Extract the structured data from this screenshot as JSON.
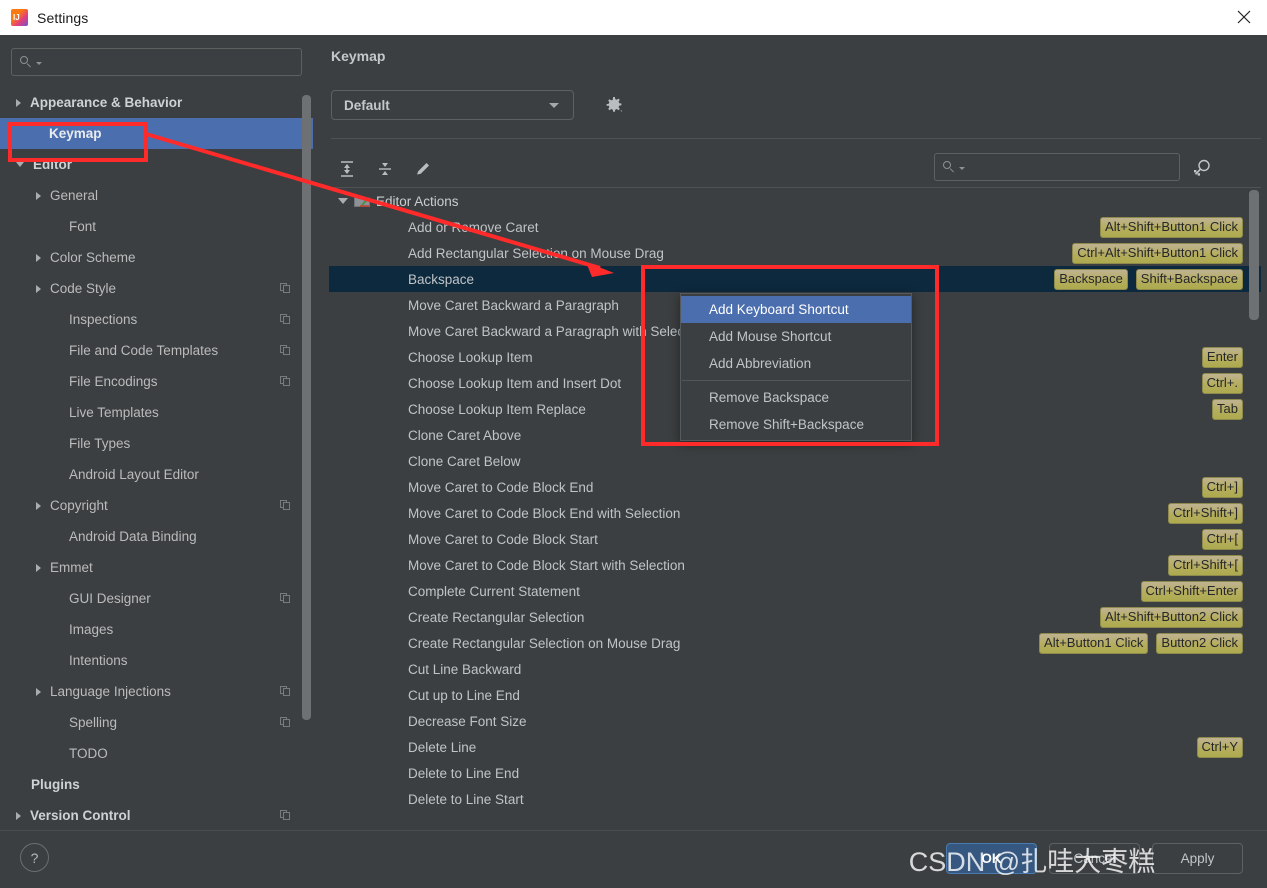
{
  "window": {
    "title": "Settings",
    "app_icon": "intellij-idea-icon",
    "close_icon": "close-icon"
  },
  "sidebar": {
    "search": {
      "placeholder": "",
      "value": "",
      "icon": "search-icon"
    },
    "items": [
      {
        "label": "Appearance & Behavior",
        "arrow": "right",
        "indent": 22,
        "bold": true,
        "copy": false,
        "selected": false
      },
      {
        "label": "Keymap",
        "arrow": "none",
        "indent": 40,
        "bold": true,
        "copy": false,
        "selected": true
      },
      {
        "label": "Editor",
        "arrow": "down",
        "indent": 22,
        "bold": true,
        "copy": false,
        "selected": false
      },
      {
        "label": "General",
        "arrow": "right",
        "indent": 42,
        "bold": false,
        "copy": false,
        "selected": false
      },
      {
        "label": "Font",
        "arrow": "none",
        "indent": 60,
        "bold": false,
        "copy": false,
        "selected": false
      },
      {
        "label": "Color Scheme",
        "arrow": "right",
        "indent": 42,
        "bold": false,
        "copy": false,
        "selected": false
      },
      {
        "label": "Code Style",
        "arrow": "right",
        "indent": 42,
        "bold": false,
        "copy": true,
        "selected": false
      },
      {
        "label": "Inspections",
        "arrow": "none",
        "indent": 60,
        "bold": false,
        "copy": true,
        "selected": false
      },
      {
        "label": "File and Code Templates",
        "arrow": "none",
        "indent": 60,
        "bold": false,
        "copy": true,
        "selected": false
      },
      {
        "label": "File Encodings",
        "arrow": "none",
        "indent": 60,
        "bold": false,
        "copy": true,
        "selected": false
      },
      {
        "label": "Live Templates",
        "arrow": "none",
        "indent": 60,
        "bold": false,
        "copy": false,
        "selected": false
      },
      {
        "label": "File Types",
        "arrow": "none",
        "indent": 60,
        "bold": false,
        "copy": false,
        "selected": false
      },
      {
        "label": "Android Layout Editor",
        "arrow": "none",
        "indent": 60,
        "bold": false,
        "copy": false,
        "selected": false
      },
      {
        "label": "Copyright",
        "arrow": "right",
        "indent": 42,
        "bold": false,
        "copy": true,
        "selected": false
      },
      {
        "label": "Android Data Binding",
        "arrow": "none",
        "indent": 60,
        "bold": false,
        "copy": false,
        "selected": false
      },
      {
        "label": "Emmet",
        "arrow": "right",
        "indent": 42,
        "bold": false,
        "copy": false,
        "selected": false
      },
      {
        "label": "GUI Designer",
        "arrow": "none",
        "indent": 60,
        "bold": false,
        "copy": true,
        "selected": false
      },
      {
        "label": "Images",
        "arrow": "none",
        "indent": 60,
        "bold": false,
        "copy": false,
        "selected": false
      },
      {
        "label": "Intentions",
        "arrow": "none",
        "indent": 60,
        "bold": false,
        "copy": false,
        "selected": false
      },
      {
        "label": "Language Injections",
        "arrow": "right",
        "indent": 42,
        "bold": false,
        "copy": true,
        "selected": false
      },
      {
        "label": "Spelling",
        "arrow": "none",
        "indent": 60,
        "bold": false,
        "copy": true,
        "selected": false
      },
      {
        "label": "TODO",
        "arrow": "none",
        "indent": 60,
        "bold": false,
        "copy": false,
        "selected": false
      },
      {
        "label": "Plugins",
        "arrow": "none",
        "indent": 22,
        "bold": true,
        "copy": false,
        "selected": false
      },
      {
        "label": "Version Control",
        "arrow": "right",
        "indent": 22,
        "bold": true,
        "copy": true,
        "selected": false
      }
    ]
  },
  "content": {
    "page_title": "Keymap",
    "keymap_select": {
      "value": "Default",
      "icon": "chevron-down-icon"
    },
    "gear_icon": "gear-icon",
    "toolbar": [
      {
        "icon": "expand-all-icon"
      },
      {
        "icon": "collapse-all-icon"
      },
      {
        "icon": "edit-pencil-icon"
      }
    ],
    "filter_search": {
      "placeholder": "",
      "value": "",
      "icon": "search-icon"
    },
    "find_shortcut_icon": "find-by-shortcut-icon",
    "actions": [
      {
        "name": "Editor Actions",
        "type": "group",
        "keys": []
      },
      {
        "name": "Add or Remove Caret",
        "type": "item",
        "keys": [
          "Alt+Shift+Button1 Click"
        ]
      },
      {
        "name": "Add Rectangular Selection on Mouse Drag",
        "type": "item",
        "keys": [
          "Ctrl+Alt+Shift+Button1 Click"
        ]
      },
      {
        "name": "Backspace",
        "type": "item",
        "keys": [
          "Backspace",
          "Shift+Backspace"
        ],
        "selected": true
      },
      {
        "name": "Move Caret Backward a Paragraph",
        "type": "item",
        "keys": []
      },
      {
        "name": "Move Caret Backward a Paragraph with Selection",
        "type": "item",
        "keys": []
      },
      {
        "name": "Choose Lookup Item",
        "type": "item",
        "keys": [
          "Enter"
        ]
      },
      {
        "name": "Choose Lookup Item and Insert Dot",
        "type": "item",
        "keys": [
          "Ctrl+."
        ]
      },
      {
        "name": "Choose Lookup Item Replace",
        "type": "item",
        "keys": [
          "Tab"
        ]
      },
      {
        "name": "Clone Caret Above",
        "type": "item",
        "keys": []
      },
      {
        "name": "Clone Caret Below",
        "type": "item",
        "keys": []
      },
      {
        "name": "Move Caret to Code Block End",
        "type": "item",
        "keys": [
          "Ctrl+]"
        ]
      },
      {
        "name": "Move Caret to Code Block End with Selection",
        "type": "item",
        "keys": [
          "Ctrl+Shift+]"
        ]
      },
      {
        "name": "Move Caret to Code Block Start",
        "type": "item",
        "keys": [
          "Ctrl+["
        ]
      },
      {
        "name": "Move Caret to Code Block Start with Selection",
        "type": "item",
        "keys": [
          "Ctrl+Shift+["
        ]
      },
      {
        "name": "Complete Current Statement",
        "type": "item",
        "keys": [
          "Ctrl+Shift+Enter"
        ]
      },
      {
        "name": "Create Rectangular Selection",
        "type": "item",
        "keys": [
          "Alt+Shift+Button2 Click"
        ]
      },
      {
        "name": "Create Rectangular Selection on Mouse Drag",
        "type": "item",
        "keys": [
          "Alt+Button1 Click",
          "Button2 Click"
        ]
      },
      {
        "name": "Cut Line Backward",
        "type": "item",
        "keys": []
      },
      {
        "name": "Cut up to Line End",
        "type": "item",
        "keys": []
      },
      {
        "name": "Decrease Font Size",
        "type": "item",
        "keys": []
      },
      {
        "name": "Delete Line",
        "type": "item",
        "keys": [
          "Ctrl+Y"
        ]
      },
      {
        "name": "Delete to Line End",
        "type": "item",
        "keys": []
      },
      {
        "name": "Delete to Line Start",
        "type": "item",
        "keys": []
      }
    ]
  },
  "context_menu": {
    "items": [
      {
        "label": "Add Keyboard Shortcut",
        "highlighted": true,
        "separator_after": false
      },
      {
        "label": "Add Mouse Shortcut",
        "highlighted": false,
        "separator_after": false
      },
      {
        "label": "Add Abbreviation",
        "highlighted": false,
        "separator_after": true
      },
      {
        "label": "Remove Backspace",
        "highlighted": false,
        "separator_after": false
      },
      {
        "label": "Remove Shift+Backspace",
        "highlighted": false,
        "separator_after": false
      }
    ]
  },
  "footer": {
    "help_label": "?",
    "ok_label": "OK",
    "cancel_label": "Cancel",
    "apply_label": "Apply"
  },
  "annotations": {
    "highlight_color": "#ff2a2a",
    "watermark": "CSDN @扎哇大枣糕"
  }
}
